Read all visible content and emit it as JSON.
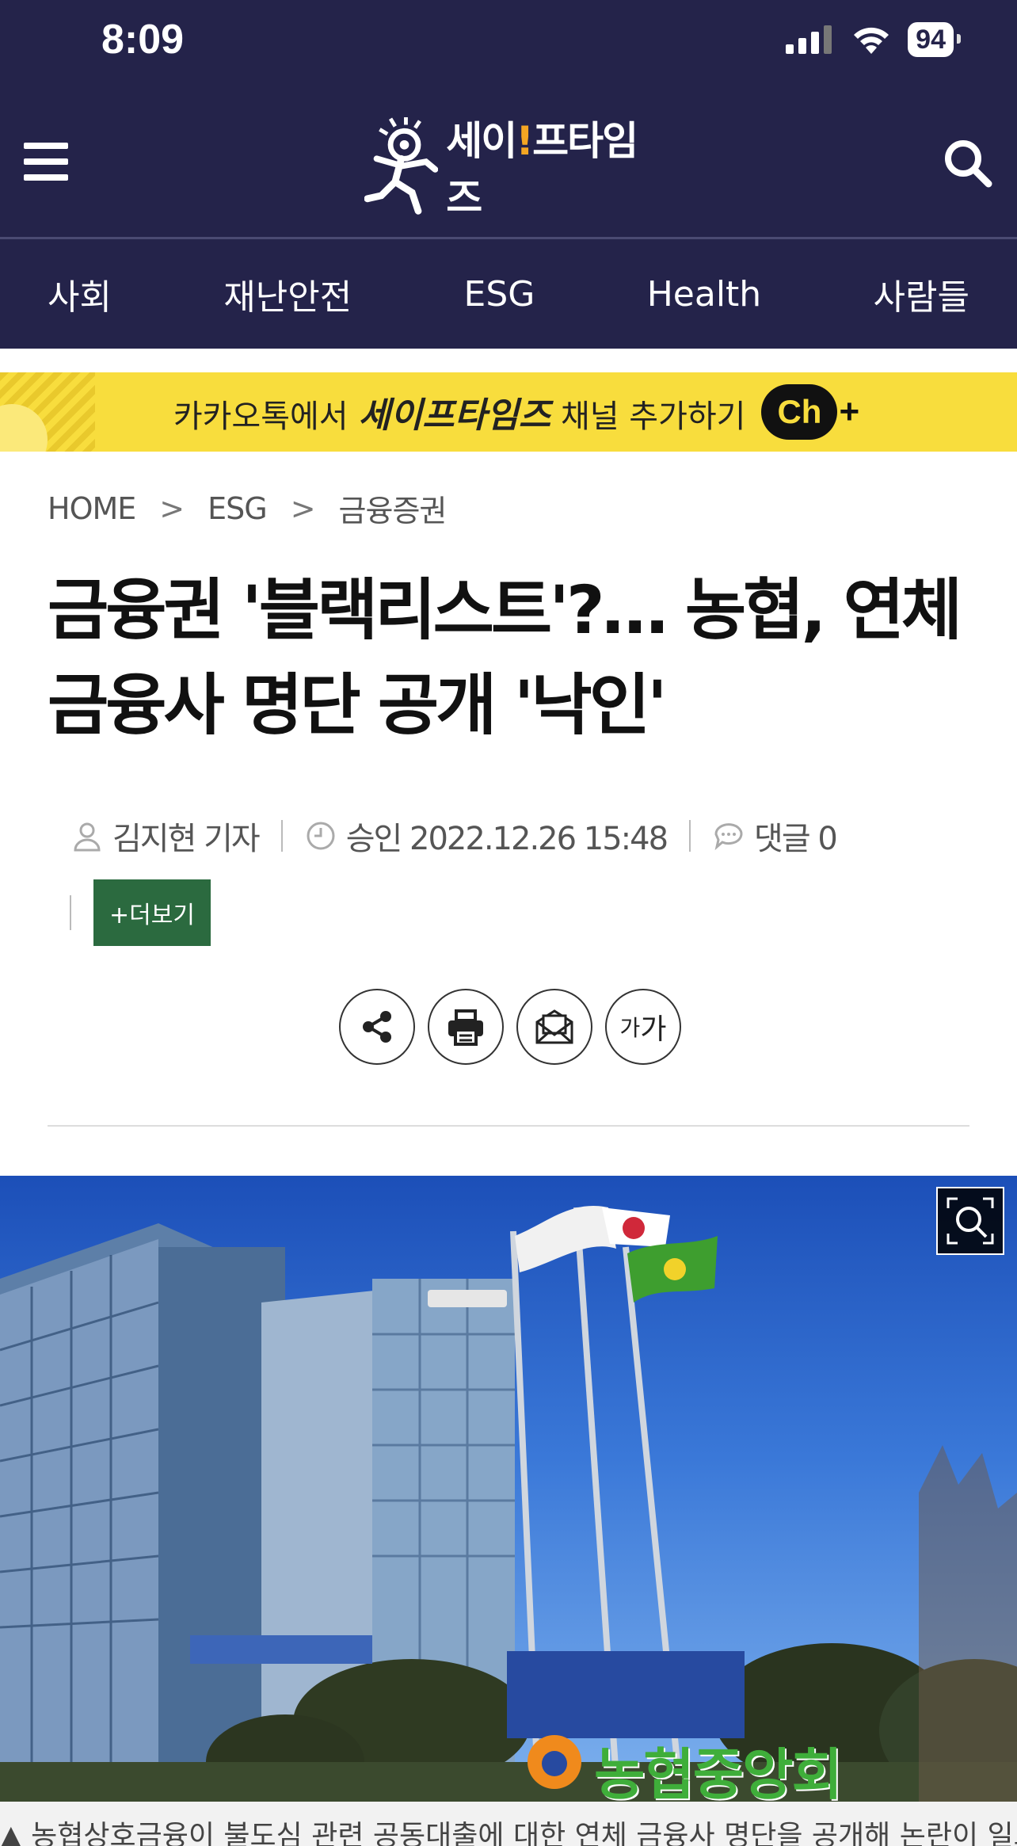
{
  "status_bar": {
    "time": "8:09",
    "battery": "94"
  },
  "header": {
    "logo_text": "세이프타임즈",
    "logo_prefix": "세이",
    "logo_bang": "!",
    "logo_suffix": "프타임즈"
  },
  "nav": {
    "items": [
      "사회",
      "재난안전",
      "ESG",
      "Health",
      "사람들"
    ]
  },
  "banner": {
    "prefix": "카카오톡에서",
    "brand": "세이프타임즈",
    "suffix": "채널 추가하기",
    "badge": "Ch",
    "plus": "+"
  },
  "breadcrumb": [
    "HOME",
    "ESG",
    "금융증권"
  ],
  "breadcrumb_separator": ">",
  "article": {
    "title": "금융권 '블랙리스트'?… 농협, 연체 금융사 명단 공개 '낙인'",
    "author": "김지현 기자",
    "approved": "승인 2022.12.26 15:48",
    "comments": "댓글 0",
    "more_label": "+더보기",
    "font_tool_small": "가",
    "font_tool_large": "가",
    "photo": {
      "building_sign": "농협중앙회",
      "caption": "▲ 농협상호금융이 불도심 관련 공동대출에 대한 연체 금융사 명단을 공개해 논란이 일고 있다."
    }
  },
  "colors": {
    "header_bg": "#24234a",
    "banner_bg": "#f8dd3d",
    "more_btn": "#2b6a3f"
  }
}
